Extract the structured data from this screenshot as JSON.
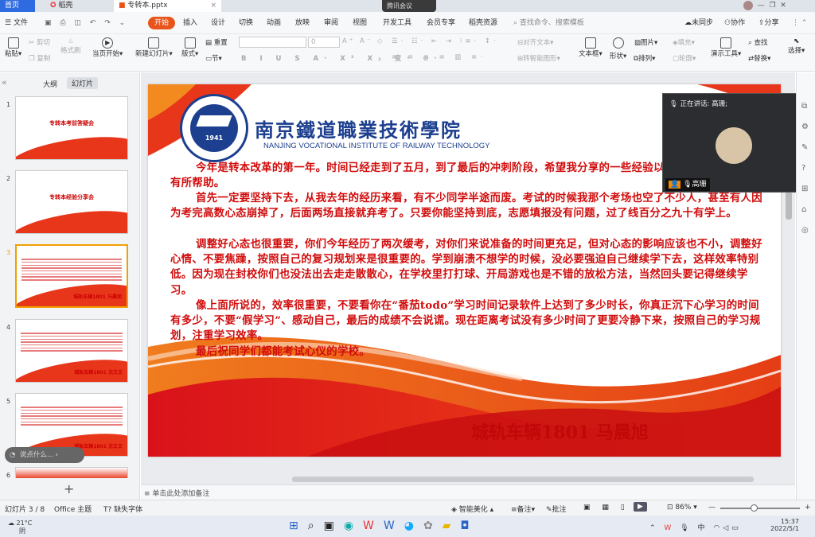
{
  "tabs": {
    "home": "首页",
    "docer": "稻壳",
    "file": "专转本.pptx",
    "meeting": "腾讯会议"
  },
  "menu": {
    "file": "文件",
    "start": "开始",
    "insert": "插入",
    "design": "设计",
    "switch": "切换",
    "animation": "动画",
    "show": "放映",
    "review": "审阅",
    "view": "视图",
    "dev": "开发工具",
    "member": "会员专享",
    "resources": "稻壳资源",
    "search": "查找命令、搜索模板",
    "unsync": "未同步",
    "collab": "协作",
    "share": "分享"
  },
  "ribbon": {
    "paste": "粘贴",
    "cut": "剪切",
    "copy": "复制",
    "format_painter": "格式刷",
    "play": "当页开始",
    "new_slide": "新建幻灯片",
    "layout": "版式",
    "section": "节",
    "reset": "重置",
    "font_size": "0",
    "align_text": "对齐文本",
    "smart_graphic": "转智能图形",
    "textbox": "文本框",
    "shape": "形状",
    "arrange": "排列",
    "picture": "图片",
    "fill": "填充",
    "outline": "轮廓",
    "present_tools": "演示工具",
    "find": "查找",
    "replace": "替换",
    "select": "选择"
  },
  "sidebar": {
    "outline": "大纲",
    "slides": "幻灯片",
    "add": "+",
    "speak_hint": "说点什么..."
  },
  "thumbs": [
    {
      "num": "1",
      "title": "专转本考前答疑会"
    },
    {
      "num": "2",
      "title": "专转本经验分享会"
    },
    {
      "num": "3",
      "title": "城轨车辆1801 马晨旭"
    },
    {
      "num": "4",
      "title": "城轨车辆1801 沈文文"
    },
    {
      "num": "5",
      "title": "城轨车辆1801 沈文文"
    },
    {
      "num": "6",
      "title": ""
    }
  ],
  "slide": {
    "school_cn": "南京鐵道職業技術學院",
    "school_en": "NANJING VOCATIONAL INSTITUTE OF RAILWAY TECHNOLOGY",
    "logo_year": "1941",
    "logo_text": "南京鐵道職業技術學院 Nanjing Vocational Institute of Railway Technology",
    "p1": "今年是转本改革的第一年。时间已经走到了五月，到了最后的冲刺阶段，希望我分享的一些经验以及心路历程能对你们有所帮助。",
    "p2": "首先一定要坚持下去，从我去年的经历来看，有不少同学半途而废。考试的时候我那个考场也空了不少人，甚至有人因为考完高数心态崩掉了，后面两场直接就弃考了。只要你能坚持到底，志愿填报没有问题，过了线百分之九十有学上。",
    "p3": "调整好心态也很重要，你们今年经历了两次缓考，对你们来说准备的时间更充足，但对心态的影响应该也不小，调整好心情、不要焦躁，按照自己的复习规划来是很重要的。学到崩溃不想学的时候，没必要强迫自己继续学下去，这样效率特别低。因为现在封校你们也没法出去走走散散心，在学校里打打球、开局游戏也是不错的放松方法，当然回头要记得继续学习。",
    "p4": "像上面所说的，效率很重要，不要看你在“番茄todo”学习时间记录软件上达到了多少时长，你真正沉下心学习的时间有多少，不要“假学习”、感动自己，最后的成绩不会说谎。现在距离考试没有多少时间了更要冷静下来，按照自己的学习规划，注重学习效率。",
    "p5": "最后祝同学们都能考试心仪的学校。",
    "signature": "城轨车辆1801 马晨旭"
  },
  "meeting": {
    "speaking": "正在讲话: 高珊;",
    "name": "高珊"
  },
  "notes": {
    "placeholder": "单击此处添加备注"
  },
  "status": {
    "slide": "幻灯片 3 / 8",
    "theme": "Office 主题",
    "missing_font": "缺失字体",
    "beautify": "智能美化",
    "notes": "备注",
    "comment": "批注",
    "zoom": "86%"
  },
  "taskbar": {
    "temp": "21°C",
    "weather": "阴",
    "ime": "中",
    "time": "15:37",
    "date": "2022/5/1"
  }
}
